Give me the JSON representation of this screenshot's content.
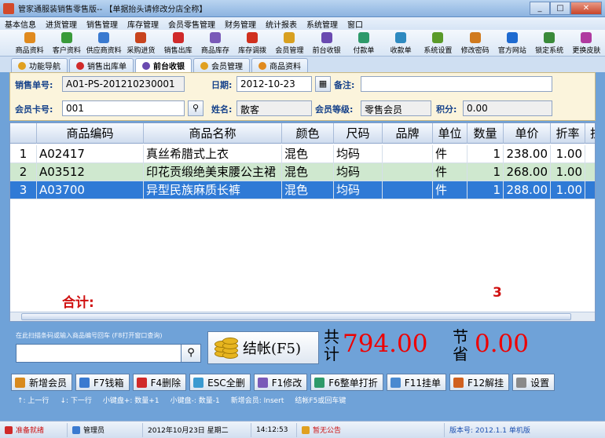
{
  "window": {
    "title": "管家通服装销售零售版-- 【单据抬头请修改分店全称】",
    "min": "_",
    "max": "□",
    "close": "✕"
  },
  "menu": [
    "基本信息",
    "进货管理",
    "销售管理",
    "库存管理",
    "会员零售管理",
    "财务管理",
    "统计报表",
    "系统管理",
    "窗口"
  ],
  "toolbar": [
    {
      "label": "商品资料",
      "icon": "product-icon",
      "color": "#e08a1e"
    },
    {
      "label": "客户资料",
      "icon": "customer-icon",
      "color": "#3a9a3a"
    },
    {
      "label": "供应商资料",
      "icon": "supplier-icon",
      "color": "#3a7ad0"
    },
    {
      "label": "采购进货",
      "icon": "purchase-icon",
      "color": "#c8441e"
    },
    {
      "label": "销售出库",
      "icon": "sales-out-icon",
      "color": "#d02a2a"
    },
    {
      "label": "商品库存",
      "icon": "stock-icon",
      "color": "#7a5ab8"
    },
    {
      "label": "库存调拨",
      "icon": "transfer-icon",
      "color": "#d0301e"
    },
    {
      "label": "会员管理",
      "icon": "member-icon",
      "color": "#d8a020"
    },
    {
      "label": "前台收银",
      "icon": "cashier-icon",
      "color": "#6a4ab0"
    },
    {
      "label": "付款单",
      "icon": "payment-icon",
      "color": "#2e9a6a"
    },
    {
      "label": "收款单",
      "icon": "receipt-icon",
      "color": "#2e8ac0"
    },
    {
      "label": "系统设置",
      "icon": "settings-icon",
      "color": "#5a9a2a"
    },
    {
      "label": "修改密码",
      "icon": "password-icon",
      "color": "#d07a1e"
    },
    {
      "label": "官方网站",
      "icon": "website-icon",
      "color": "#1e6ad0"
    },
    {
      "label": "锁定系统",
      "icon": "lock-icon",
      "color": "#3a8a3a"
    },
    {
      "label": "更换皮肤",
      "icon": "skin-icon",
      "color": "#b03aa0"
    }
  ],
  "tabs": [
    {
      "label": "功能导航",
      "color": "#e0a020"
    },
    {
      "label": "销售出库单",
      "color": "#d02a2a"
    },
    {
      "label": "前台收银",
      "color": "#6a4ab0"
    },
    {
      "label": "会员管理",
      "color": "#e0a020"
    },
    {
      "label": "商品资料",
      "color": "#e08a1e"
    }
  ],
  "form": {
    "order_no_label": "销售单号:",
    "order_no": "A01-PS-201210230001",
    "date_label": "日期:",
    "date": "2012-10-23",
    "date_btn": "▦",
    "note_label": "备注:",
    "note": "",
    "card_label": "会员卡号:",
    "card": "001",
    "card_btn": "⚲",
    "name_label": "姓名:",
    "name": "散客",
    "level_label": "会员等级:",
    "level": "零售会员",
    "points_label": "积分:",
    "points": "0.00"
  },
  "grid": {
    "headers": [
      "",
      "商品编码",
      "商品名称",
      "颜色",
      "尺码",
      "品牌",
      "单位",
      "数量",
      "单价",
      "折率",
      "折"
    ],
    "rows": [
      [
        "1",
        "A02417",
        "真丝希腊式上衣",
        "混色",
        "均码",
        "",
        "件",
        "1",
        "238.00",
        "1.00"
      ],
      [
        "2",
        "A03512",
        "印花贡缎绝美束腰公主裙",
        "混色",
        "均码",
        "",
        "件",
        "1",
        "268.00",
        "1.00"
      ],
      [
        "3",
        "A03700",
        "异型民族麻质长裤",
        "混色",
        "均码",
        "",
        "件",
        "1",
        "288.00",
        "1.00"
      ]
    ],
    "total_label": "合计:",
    "total_qty": "3"
  },
  "bottom": {
    "scan_hint": "在此扫描条码或输入商品编号回车 (F8打开窗口查询)",
    "scan_btn": "⚲",
    "checkout": "结帐(F5)",
    "total_text": "共计",
    "total_amount": "794.00",
    "save_text": "节省",
    "save_amount": "0.00"
  },
  "fkeys": [
    {
      "label": "新增会员",
      "color": "#d88a1e"
    },
    {
      "label": "F7钱箱",
      "color": "#3a7ad0"
    },
    {
      "label": "F4删除",
      "color": "#d02a2a"
    },
    {
      "label": "ESC全删",
      "color": "#3a9ad0"
    },
    {
      "label": "F1修改",
      "color": "#7a5ab8"
    },
    {
      "label": "F6整单打折",
      "color": "#2e9a6a"
    },
    {
      "label": "F11挂单",
      "color": "#4a8ad0"
    },
    {
      "label": "F12解挂",
      "color": "#d0601e"
    },
    {
      "label": "设置",
      "color": "#8a8a8a"
    }
  ],
  "hints": [
    "↑: 上一行",
    "↓: 下一行",
    "小键盘+: 数量+1",
    "小键盘-: 数量-1",
    "新增会员: Insert",
    "结帐F5或回车键"
  ],
  "status": {
    "ready": "准备就绪",
    "user": "管理员",
    "date": "2012年10月23日 星期二",
    "time": "14:12:53",
    "notice": "暂无公告",
    "version": "版本号: 2012.1.1 单机版"
  }
}
